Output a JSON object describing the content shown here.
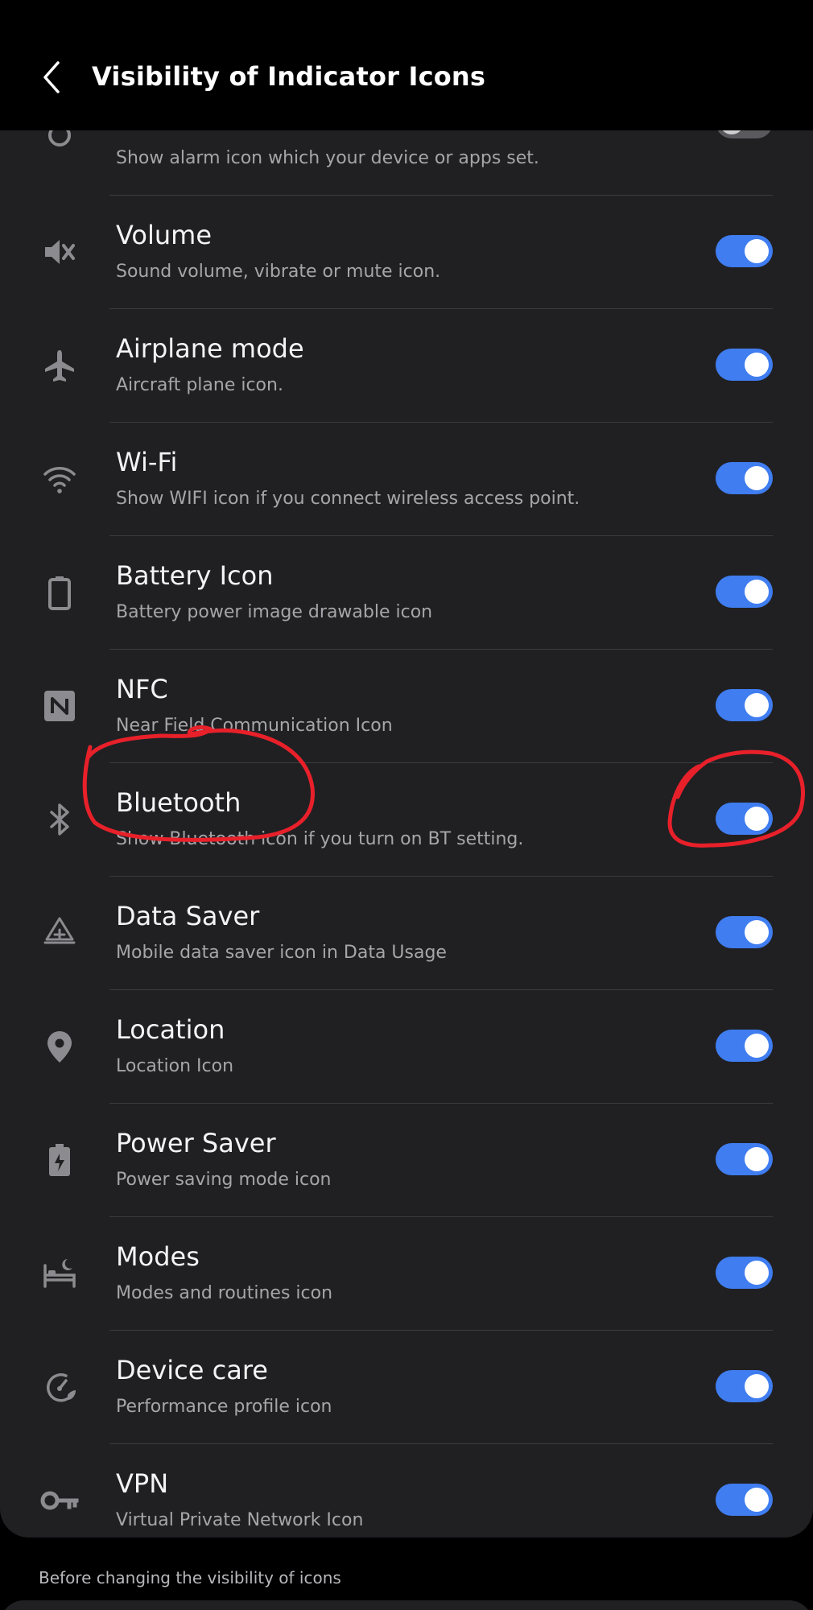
{
  "header": {
    "title": "Visibility of Indicator Icons"
  },
  "partial_row": {
    "subtitle": "Show alarm icon which your device or apps set."
  },
  "rows": [
    {
      "title": "Volume",
      "subtitle": "Sound volume, vibrate or mute icon.",
      "icon": "volume-mute-icon",
      "enabled": true
    },
    {
      "title": "Airplane mode",
      "subtitle": "Aircraft plane icon.",
      "icon": "airplane-icon",
      "enabled": true
    },
    {
      "title": "Wi-Fi",
      "subtitle": "Show WIFI icon if you connect wireless access point.",
      "icon": "wifi-icon",
      "enabled": true
    },
    {
      "title": "Battery Icon",
      "subtitle": "Battery power image drawable icon",
      "icon": "battery-icon",
      "enabled": true
    },
    {
      "title": "NFC",
      "subtitle": "Near Field Communication Icon",
      "icon": "nfc-icon",
      "enabled": true
    },
    {
      "title": "Bluetooth",
      "subtitle": "Show Bluetooth icon if you turn on BT setting.",
      "icon": "bluetooth-icon",
      "enabled": true
    },
    {
      "title": "Data Saver",
      "subtitle": "Mobile data saver icon in Data Usage",
      "icon": "data-saver-icon",
      "enabled": true
    },
    {
      "title": "Location",
      "subtitle": "Location Icon",
      "icon": "location-pin-icon",
      "enabled": true
    },
    {
      "title": "Power Saver",
      "subtitle": "Power saving mode icon",
      "icon": "power-saver-icon",
      "enabled": true
    },
    {
      "title": "Modes",
      "subtitle": "Modes and routines icon",
      "icon": "bed-moon-icon",
      "enabled": true
    },
    {
      "title": "Device care",
      "subtitle": "Performance profile icon",
      "icon": "device-care-icon",
      "enabled": true
    },
    {
      "title": "VPN",
      "subtitle": "Virtual Private Network Icon",
      "icon": "key-icon",
      "enabled": true
    }
  ],
  "footer": {
    "note": "Before changing the visibility of icons"
  },
  "colors": {
    "toggle_on": "#3f7df0",
    "card_bg": "#202023",
    "annotation": "#e8202a"
  }
}
